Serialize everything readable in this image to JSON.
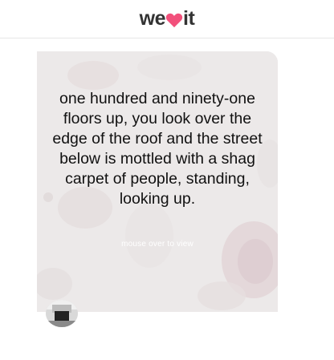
{
  "header": {
    "logo_prefix": "we",
    "logo_suffix": "it"
  },
  "card": {
    "quote": "one hundred and ninety-one floors up, you look over the edge of the roof and the street below is mottled with a shag carpet of people, standing, looking up.",
    "hint": "mouse over to view"
  },
  "colors": {
    "brand_heart": "#f2507b",
    "card_bg": "#ece9e9"
  }
}
